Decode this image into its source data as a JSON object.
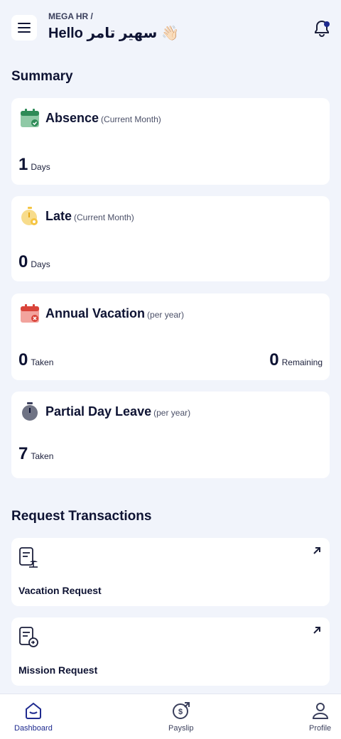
{
  "header": {
    "app_crumb": "MEGA HR /",
    "greeting": "Hello سهير تامر",
    "wave_emoji": "👋🏻"
  },
  "summary": {
    "title": "Summary",
    "absence": {
      "title": "Absence",
      "subtitle": "(Current Month)",
      "value": "1",
      "unit": "Days"
    },
    "late": {
      "title": "Late",
      "subtitle": "(Current Month)",
      "value": "0",
      "unit": "Days"
    },
    "annual_vacation": {
      "title": "Annual Vacation",
      "subtitle": "(per year)",
      "taken_value": "0",
      "taken_label": "Taken",
      "remaining_value": "0",
      "remaining_label": "Remaining"
    },
    "partial_leave": {
      "title": "Partial Day Leave",
      "subtitle": "(per year)",
      "value": "7",
      "unit": "Taken"
    }
  },
  "requests": {
    "title": "Request Transactions",
    "items": [
      {
        "label": "Vacation Request"
      },
      {
        "label": "Mission Request"
      }
    ]
  },
  "bottom_nav": {
    "items": [
      {
        "label": "Dashboard",
        "icon": "home-icon",
        "active": true
      },
      {
        "label": "Payslip",
        "icon": "payslip-icon",
        "active": false
      },
      {
        "label": "Profile",
        "icon": "profile-icon",
        "active": false
      }
    ]
  },
  "colors": {
    "background": "#f1f4fb",
    "accent": "#1e2a8f",
    "text": "#0e1333",
    "absence_green": "#2e8b57",
    "late_yellow": "#f5c542",
    "vacation_red": "#d9443a",
    "timer_gray": "#6f7384"
  }
}
